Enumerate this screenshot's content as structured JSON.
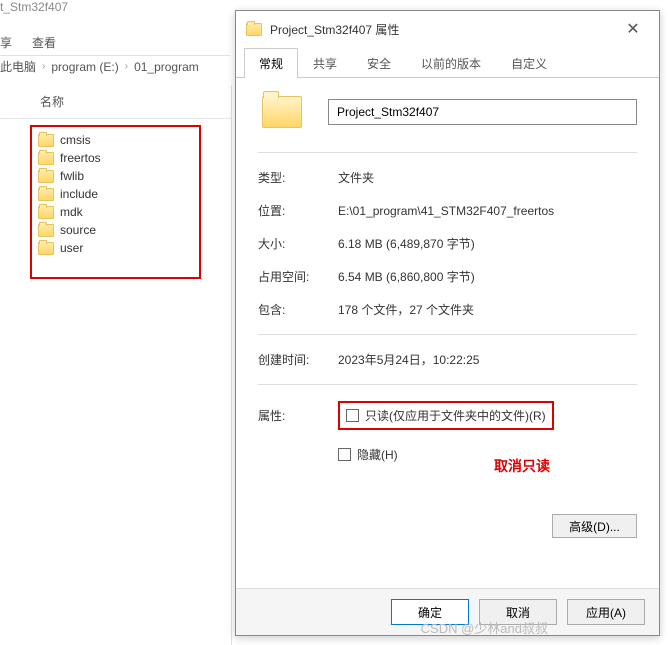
{
  "explorer": {
    "title_fragment": "t_Stm32f407",
    "menu": {
      "share_alt": "享",
      "view": "查看"
    },
    "breadcrumb": {
      "pc": "此电脑",
      "drive": "program (E:)",
      "folder": "01_program"
    },
    "column_header": "名称",
    "folders": [
      "cmsis",
      "freertos",
      "fwlib",
      "include",
      "mdk",
      "source",
      "user"
    ]
  },
  "dialog": {
    "title": "Project_Stm32f407 属性",
    "close_glyph": "✕",
    "tabs": {
      "general": "常规",
      "share": "共享",
      "security": "安全",
      "previous": "以前的版本",
      "custom": "自定义"
    },
    "name_value": "Project_Stm32f407",
    "rows": {
      "type_label": "类型:",
      "type_value": "文件夹",
      "location_label": "位置:",
      "location_value": "E:\\01_program\\41_STM32F407_freertos",
      "size_label": "大小:",
      "size_value": "6.18 MB (6,489,870 字节)",
      "ondisk_label": "占用空间:",
      "ondisk_value": "6.54 MB (6,860,800 字节)",
      "contains_label": "包含:",
      "contains_value": "178 个文件，27 个文件夹",
      "created_label": "创建时间:",
      "created_value": "2023年5月24日，10:22:25",
      "attr_label": "属性:",
      "readonly_label": "只读(仅应用于文件夹中的文件)(R)",
      "hidden_label": "隐藏(H)",
      "advanced_label": "高级(D)..."
    },
    "annotation": "取消只读",
    "buttons": {
      "ok": "确定",
      "cancel": "取消",
      "apply": "应用(A)"
    }
  },
  "watermark": "CSDN @少林and叔叔"
}
